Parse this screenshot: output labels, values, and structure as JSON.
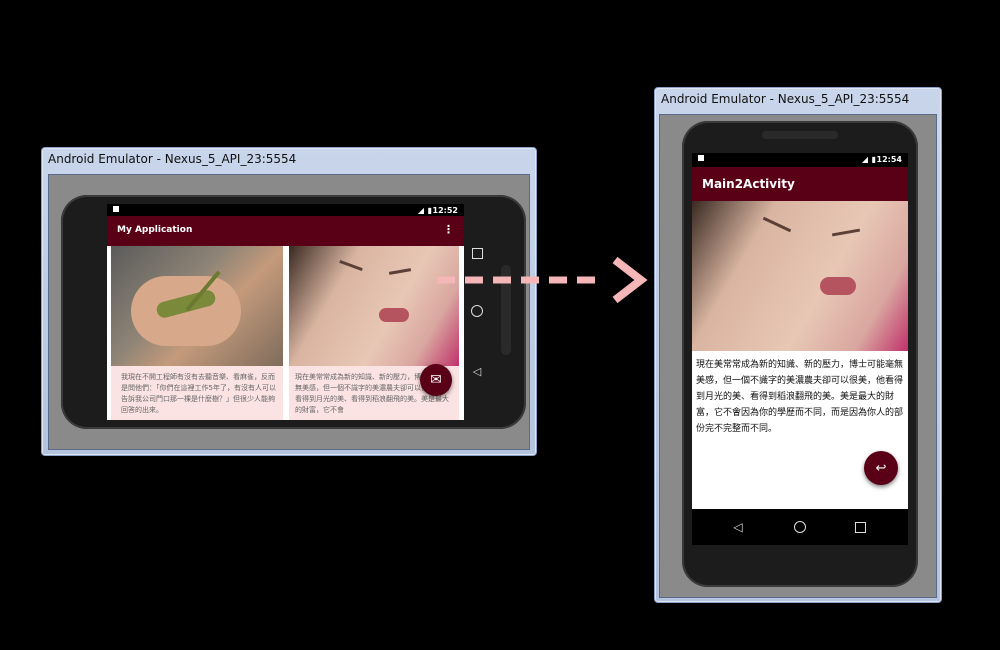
{
  "left_window": {
    "title": "Android Emulator - Nexus_5_API_23:5554",
    "status": {
      "time": "12:52"
    },
    "app_title": "My Application",
    "cards": [
      {
        "text": "我現在不開工程師有沒有去聽音樂、看麻雀，反而是問他們：「你們在這裡工作5年了，有沒有人可以告訴我公司門口那一棵是什麼樹？」但很少人能夠回答的出來。"
      },
      {
        "text": "現在美常常成為新的知識、新的壓力，博士可能毫無美感，但一個不識字的美濃農夫卻可以很美，他看得到月光的美、看得到稻浪翻飛的美。美是最大的財富，它不會"
      }
    ]
  },
  "right_window": {
    "title": "Android Emulator - Nexus_5_API_23:5554",
    "status": {
      "time": "12:54"
    },
    "app_title": "Main2Activity",
    "body_text": "現在美常常成為新的知識、新的壓力，博士可能毫無美感，但一個不識字的美濃農夫卻可以很美，他看得到月光的美、看得到稻浪翻飛的美。美是最大的財富，它不會因為你的學歷而不同，而是因為你人的部份完不完整而不同。"
  },
  "icons": [
    "overflow-menu-icon",
    "email-icon",
    "back-arrow-icon",
    "nav-back-icon",
    "nav-home-icon",
    "nav-recents-icon",
    "signal-icon",
    "battery-icon",
    "arrow-icon"
  ],
  "colors": {
    "appbar": "#5a0016",
    "card": "#fbe3e3",
    "arrow": "#f4b6b6"
  }
}
